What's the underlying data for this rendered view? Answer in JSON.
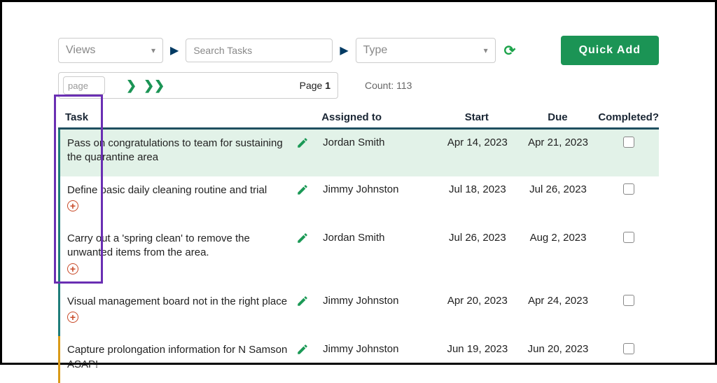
{
  "toolbar": {
    "views_label": "Views",
    "search_placeholder": "Search Tasks",
    "type_label": "Type",
    "quick_add_label": "Quick Add"
  },
  "pager": {
    "page_placeholder": "page",
    "page_label_prefix": "Page ",
    "page_number": "1",
    "count_label": "Count: 113"
  },
  "columns": {
    "task": "Task",
    "assigned": "Assigned to",
    "start": "Start",
    "due": "Due",
    "completed": "Completed?"
  },
  "rows": [
    {
      "task": "Pass on congratulations to team for sustaining the quarantine area",
      "assigned": "Jordan Smith",
      "start": "Apr 14, 2023",
      "due": "Apr 21, 2023",
      "highlight": true,
      "has_expand": false,
      "border": "teal"
    },
    {
      "task": "Define basic daily cleaning routine and trial",
      "assigned": "Jimmy Johnston",
      "start": "Jul 18, 2023",
      "due": "Jul 26, 2023",
      "highlight": false,
      "has_expand": true,
      "border": "teal"
    },
    {
      "task": "Carry out a 'spring clean' to remove the unwanted items from the area.",
      "assigned": "Jordan Smith",
      "start": "Jul 26, 2023",
      "due": "Aug 2, 2023",
      "highlight": false,
      "has_expand": true,
      "border": "teal"
    },
    {
      "task": "Visual management board not in the right place",
      "assigned": "Jimmy Johnston",
      "start": "Apr 20, 2023",
      "due": "Apr 24, 2023",
      "highlight": false,
      "has_expand": true,
      "border": "teal"
    },
    {
      "task": "Capture prolongation information for N Samson ASAP!",
      "assigned": "Jimmy Johnston",
      "start": "Jun 19, 2023",
      "due": "Jun 20, 2023",
      "highlight": false,
      "has_expand": false,
      "border": "orange"
    }
  ]
}
